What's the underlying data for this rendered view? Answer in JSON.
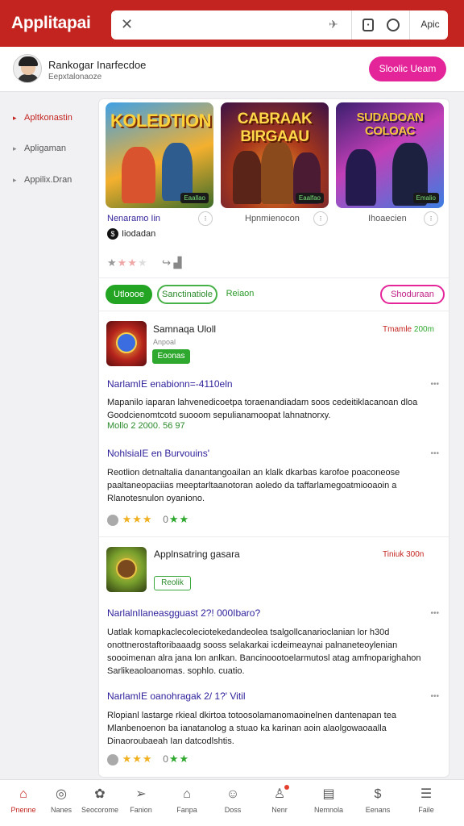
{
  "header": {
    "brand": "Applitapai",
    "search_placeholder": "",
    "apply_label": "Apic"
  },
  "user": {
    "name": "Rankogar Inarfecdoe",
    "subtitle": "Eepxtalonaoze",
    "cta_label": "Sloolic Ueam"
  },
  "sidebar": {
    "items": [
      {
        "label": "Apltkonastin",
        "active": true
      },
      {
        "label": "Apligaman",
        "active": false
      },
      {
        "label": "Appilix.Dran",
        "active": false
      }
    ]
  },
  "featured": {
    "games": [
      {
        "title": "KOLEDTION",
        "tag": "Eaallao"
      },
      {
        "title": "CABRAAK BIRGAAU",
        "tag": "Eaalfao"
      },
      {
        "title": "SUDADOAN COLOAC",
        "tag": "Emalio"
      }
    ],
    "names": [
      "Nenaramo Iin",
      "Hpnmienocon",
      "Ihoaecien"
    ],
    "publisher": "Iiodadan",
    "rating": {
      "stars_filled": 1,
      "stars_half": 2,
      "stars_total": 4
    }
  },
  "filters": {
    "pill1": "Utloooe",
    "pill2": "Sanctinatiole",
    "pill3": "Reiaon",
    "pill4": "Shoduraan"
  },
  "apps": [
    {
      "title": "Samnaqa Uloll",
      "subtitle": "Anpoal",
      "button": "Eoonas",
      "meta_prefix": "Tmamle",
      "meta_value": "200m",
      "sections": [
        {
          "heading": "NarlamIE enabionn=-4110eln",
          "text": "Mapanilo iaparan lahvenedicoetpa toraenandiadam soos cedeitiklacanoan dloa Goodcienomtcotd suooom sepulianamoopat lahnatnorxy.",
          "green": "Mollo 2 2000. 56 97"
        },
        {
          "heading": "NohlsiaIE en Burvouins'",
          "text": "Reotlion detnaltalia danantangoailan an klalk dkarbas karofoe poaconeose paaltaneopaciias meeptarltaanotoran aoledo da taffarlamegoatmiooaoin a Rlanotesnulon oyaniono."
        }
      ],
      "rating": {
        "yellow_stars": 3,
        "green_count": "0",
        "green_stars": 2
      }
    },
    {
      "title": "Applnsatring gasara",
      "subtitle": "",
      "button": "Reolik",
      "meta_prefix": "Tiniuk",
      "meta_value": "300n",
      "sections": [
        {
          "heading": "NarlalnIlaneasgguast 2?! 000Ibaro?",
          "text": "Uatlak komapkaclecoleciotekedandeolea tsalgollcanarioclanian lor h30d onottnerostaftoribaaadg sooss selakarkai icdeimeaynai palnaneteoylenian soooimenan alra jana lon anlkan. Bancinoootoelarmutosl atag amfnoparighahon Sarlikeaoloanomas. sophlo. cuatio.",
          "green": ""
        },
        {
          "heading": "NarlamIE oanohragak 2/ 1?' Vitil",
          "text": "Rlopianl lastarge rkieal dkirtoa totoosolamanomaoinelnen dantenapan tea Mlanbenoenon ba ianatanolog a stuao ka karinan aoin alaolgowaoaalla Dinaoroubaeah Ian datcodlshtis."
        }
      ],
      "rating": {
        "yellow_stars": 3,
        "green_count": "0",
        "green_stars": 2
      }
    }
  ],
  "bottom_nav": [
    {
      "label": "Pnenne",
      "icon": "home-icon",
      "active": true
    },
    {
      "label": "Nanes",
      "icon": "coin-icon",
      "active": false
    },
    {
      "label": "Seocorome",
      "icon": "leaf-icon",
      "active": false
    },
    {
      "label": "Fanion",
      "icon": "send-icon",
      "active": false
    },
    {
      "label": "Fanpa",
      "icon": "house-outline-icon",
      "active": false
    },
    {
      "label": "Doss",
      "icon": "smile-icon",
      "active": false
    },
    {
      "label": "Nenr",
      "icon": "user-icon",
      "active": false,
      "badge": true
    },
    {
      "label": "Nemnola",
      "icon": "chart-icon",
      "active": false
    },
    {
      "label": "Eenans",
      "icon": "dollar-icon",
      "active": false
    },
    {
      "label": "Faile",
      "icon": "settings-icon",
      "active": false
    }
  ],
  "colors": {
    "brand_red": "#c3241f",
    "accent_pink": "#e4259a",
    "accent_green": "#2ea82e",
    "heading_blue": "#2c1f9a"
  }
}
